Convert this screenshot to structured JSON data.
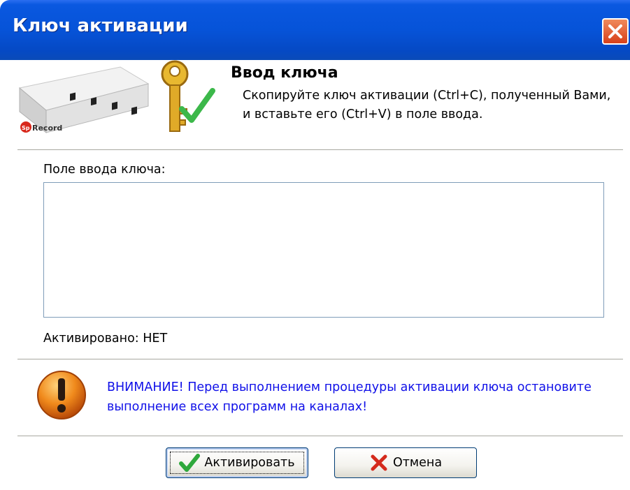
{
  "window": {
    "title": "Ключ активации",
    "close_icon": "close-icon"
  },
  "header": {
    "logo_text": "SpRecord",
    "title": "Ввод ключа",
    "description": "Скопируйте ключ активации (Ctrl+C), полученный Вами, и вставьте его (Ctrl+V) в поле ввода."
  },
  "key_field": {
    "label": "Поле ввода ключа:",
    "value": ""
  },
  "status": {
    "text": "Активировано: НЕТ"
  },
  "warning": {
    "icon": "warning-icon",
    "text": "ВНИМАНИЕ! Перед выполнением процедуры активации ключа остановите выполнение всех программ на каналах!"
  },
  "buttons": {
    "activate": {
      "label": "Активировать",
      "icon": "checkmark-icon"
    },
    "cancel": {
      "label": "Отмена",
      "icon": "cross-icon"
    }
  },
  "colors": {
    "titlebar": "#0653d8",
    "warning_text": "#1010e8",
    "close_button": "#d8401a"
  }
}
